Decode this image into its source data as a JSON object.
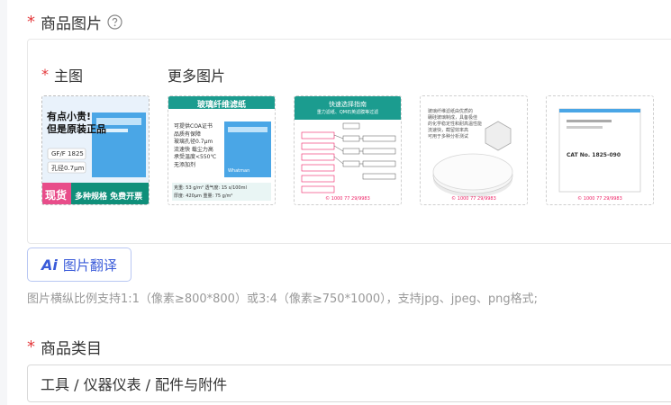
{
  "product_images": {
    "title": "商品图片",
    "required_mark": "*",
    "main_label": "主图",
    "more_label": "更多图片",
    "main_image": {
      "line1": "有点小贵!",
      "line2": "但是原装正品",
      "spec1": "GF/F 1825",
      "spec2": "孔径0.7μm",
      "banner_tag": "现货",
      "banner_text": "多种规格 免费开票"
    },
    "more_images": [
      {
        "title": "玻璃纤维滤纸",
        "lines": [
          "可提供COA证书",
          "品质有保障",
          "玻璃孔径0.7μm",
          "流速快 载尘力高",
          "承受温度<550℃",
          "无添加剂"
        ],
        "spec_row1": "克重: 53 g/m²   透气度: 15 s/100ml",
        "spec_row2": "厚度: 420μm   重量: 75 g/m²",
        "brand": "Whatman"
      },
      {
        "title": "快速选择指南",
        "subtitle": "重力滤纸、QM石英滤膜等过滤",
        "watermark": "© 1000 77 29/9983"
      },
      {
        "lines": [
          "玻璃纤维滤纸由优质的",
          "硼硅玻璃制成，具备极佳",
          "的化学稳定性和耐高温性能",
          "流速快，截留效率高",
          "可用于多种分析测试"
        ],
        "watermark": "© 1000 77 29/9983"
      },
      {
        "box_label": "CAT No. 1825-090",
        "watermark": "© 1000 77 29/9983"
      }
    ]
  },
  "translate_button": {
    "icon_text": "Ai",
    "label": "图片翻译"
  },
  "hint": "图片横纵比例支持1:1（像素≥800*800）或3:4（像素≥750*1000），支持jpg、jpeg、png格式;",
  "category": {
    "title": "商品类目",
    "required_mark": "*",
    "value": "工具 / 仪器仪表 / 配件与附件"
  },
  "colors": {
    "required": "#e4393c",
    "accent": "#3a5bd9",
    "hint": "#999999",
    "border": "#d9d9d9"
  }
}
